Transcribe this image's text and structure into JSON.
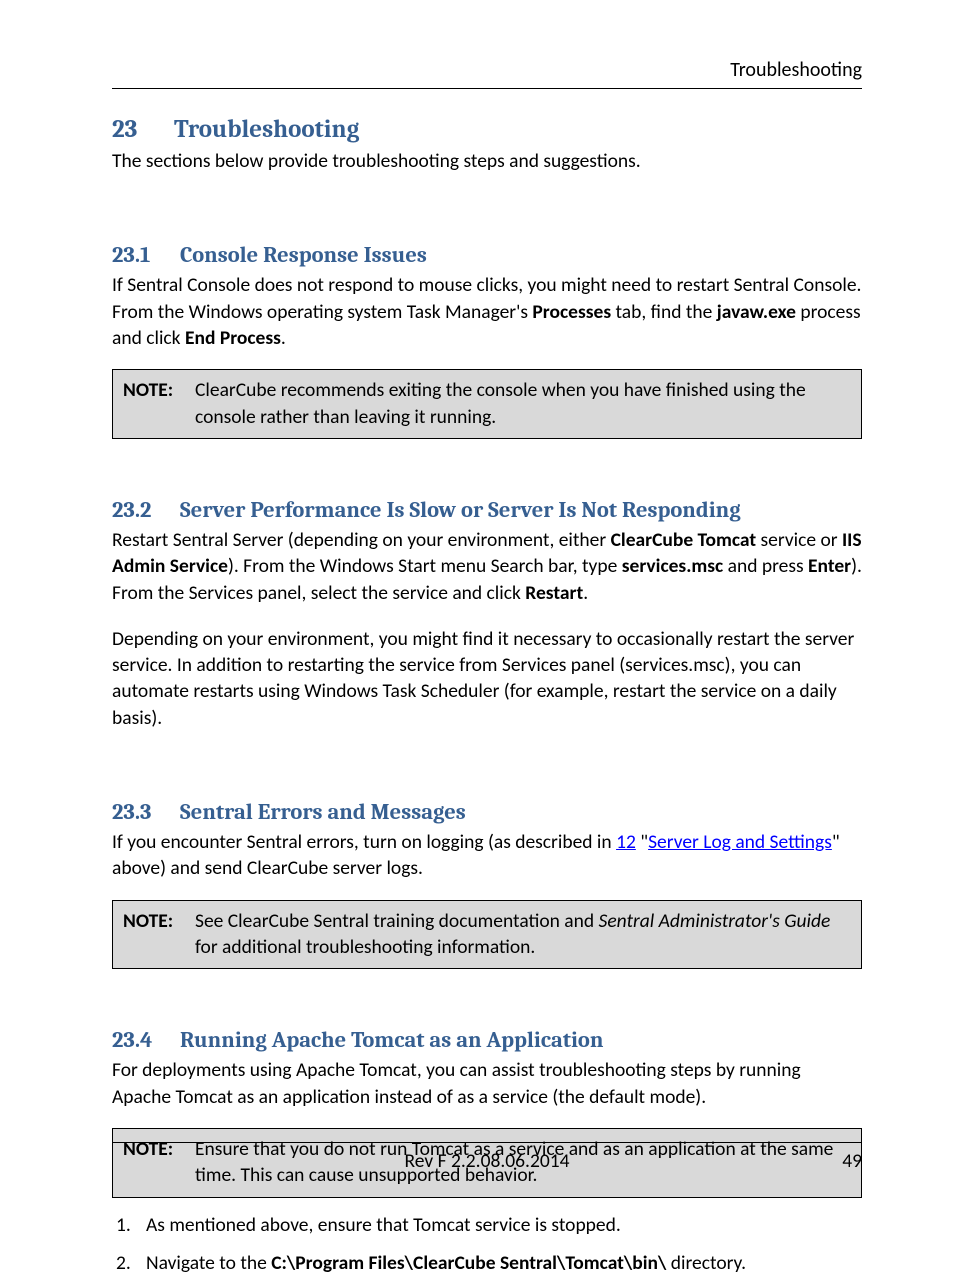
{
  "header": {
    "label": "Troubleshooting"
  },
  "h1": {
    "num": "23",
    "title": "Troubleshooting"
  },
  "intro": "The sections below provide troubleshooting steps and suggestions.",
  "s1": {
    "num": "23.1",
    "title": "Console Response Issues",
    "p_a": "If Sentral Console does not respond to mouse clicks, you might need to restart Sentral Console. From the Windows operating system Task Manager's ",
    "p_b": "Processes",
    "p_c": " tab, find the ",
    "p_d": "javaw.exe",
    "p_e": " process and click ",
    "p_f": "End Process",
    "p_g": ".",
    "note_label": "NOTE:",
    "note": "ClearCube recommends exiting the console when you have finished using the console rather than leaving it running."
  },
  "s2": {
    "num": "23.2",
    "title": "Server Performance Is Slow or Server Is Not Responding",
    "p1_a": "Restart Sentral Server (depending on your environment, either ",
    "p1_b": "ClearCube Tomcat",
    "p1_c": " service or ",
    "p1_d": "IIS Admin Service",
    "p1_e": "). From the Windows Start menu Search bar, type ",
    "p1_f": "services.msc",
    "p1_g": " and press ",
    "p1_h": "Enter",
    "p1_i": "). From the Services panel, select the service and click ",
    "p1_j": "Restart",
    "p1_k": ".",
    "p2": "Depending on your environment, you might find it necessary to occasionally restart the server service. In addition to restarting the service from Services panel (services.msc), you can automate restarts using Windows Task Scheduler (for example, restart the service on a daily basis)."
  },
  "s3": {
    "num": "23.3",
    "title": "Sentral Errors and Messages",
    "p_a": "If you encounter Sentral errors, turn on logging (as described in ",
    "link1": "12",
    "p_b": " \"",
    "link2": "Server Log and Settings",
    "p_c": "\" above) and send ClearCube server logs.",
    "note_label": "NOTE:",
    "note_a": "See ClearCube Sentral training documentation and ",
    "note_b": "Sentral Administrator's Guide",
    "note_c": " for additional troubleshooting information."
  },
  "s4": {
    "num": "23.4",
    "title": "Running Apache Tomcat as an Application",
    "p": "For deployments using Apache Tomcat, you can assist troubleshooting steps by running Apache Tomcat as an application instead of as a service (the default mode).",
    "note_label": "NOTE:",
    "note": "Ensure that you do not run Tomcat as a service and as an application at the same time. This can cause unsupported behavior.",
    "step1_num": "1.",
    "step1": "As mentioned above, ensure that Tomcat service is stopped.",
    "step2_num": "2.",
    "step2_a": "Navigate to the ",
    "step2_b": "C:\\Program Files\\ClearCube Sentral\\Tomcat\\bin\\",
    "step2_c": " directory."
  },
  "footer": {
    "rev": "Rev F 2.2.08.06.2014",
    "page": "49"
  }
}
